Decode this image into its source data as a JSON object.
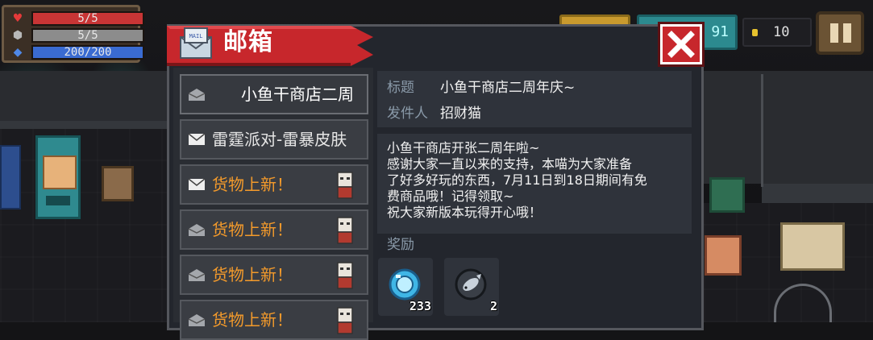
{
  "hud": {
    "hp": "5/5",
    "armor": "5/5",
    "energy": "200/200",
    "coins": "10",
    "gems_partial": "91"
  },
  "mail": {
    "title": "邮箱",
    "icon_text": "MAIL",
    "items": [
      {
        "label": "小鱼干商店二周",
        "color": "white",
        "read": true,
        "sender_icon": false
      },
      {
        "label": "雷霆派对-雷暴皮肤",
        "color": "white",
        "read": false,
        "sender_icon": false
      },
      {
        "label": "货物上新！",
        "color": "orange",
        "read": false,
        "sender_icon": true
      },
      {
        "label": "货物上新！",
        "color": "orange",
        "read": true,
        "sender_icon": true
      },
      {
        "label": "货物上新！",
        "color": "orange",
        "read": true,
        "sender_icon": true
      },
      {
        "label": "货物上新！",
        "color": "orange",
        "read": true,
        "sender_icon": true
      }
    ],
    "detail": {
      "subject_label": "标题",
      "subject": "小鱼干商店二周年庆~",
      "sender_label": "发件人",
      "sender": "招财猫",
      "body_lines": [
        "小鱼干商店开张二周年啦~",
        "感谢大家一直以来的支持，本喵为大家准备",
        "了好多好玩的东西，7月11日到18日期间有免",
        "费商品哦！记得领取~",
        "祝大家新版本玩得开心哦！"
      ],
      "reward_label": "奖励",
      "rewards": [
        {
          "icon": "gem-icon",
          "count": "233"
        },
        {
          "icon": "fish-icon",
          "count": "2"
        }
      ]
    }
  },
  "colors": {
    "accent_red": "#c7272c",
    "orange_text": "#f39a2b",
    "panel_bg": "#23262d"
  }
}
